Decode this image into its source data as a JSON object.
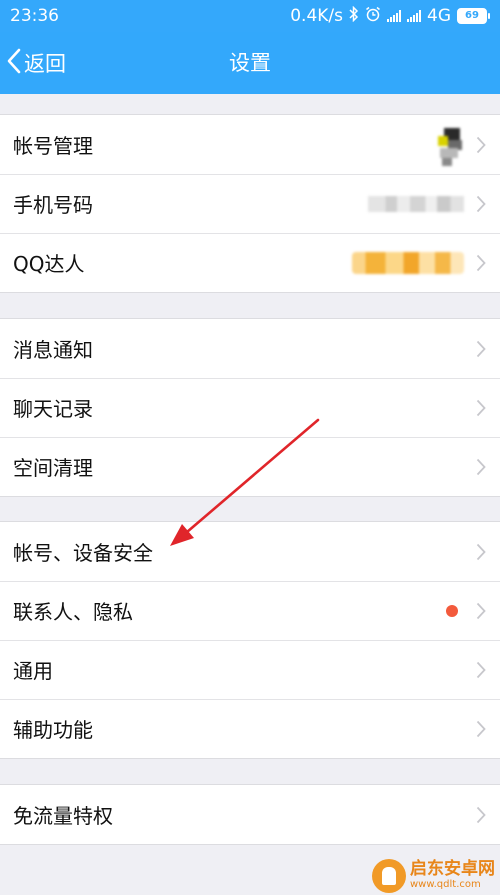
{
  "status_bar": {
    "time": "23:36",
    "network_speed": "0.4K/s",
    "network_type": "4G",
    "battery": "69",
    "icons": [
      "bluetooth-icon",
      "alarm-icon",
      "signal-icon",
      "battery-icon"
    ]
  },
  "nav": {
    "back_label": "返回",
    "title": "设置"
  },
  "groups": [
    {
      "items": [
        {
          "label": "帐号管理"
        },
        {
          "label": "手机号码"
        },
        {
          "label": "QQ达人"
        }
      ]
    },
    {
      "items": [
        {
          "label": "消息通知"
        },
        {
          "label": "聊天记录"
        },
        {
          "label": "空间清理"
        }
      ]
    },
    {
      "items": [
        {
          "label": "帐号、设备安全"
        },
        {
          "label": "联系人、隐私"
        },
        {
          "label": "通用"
        },
        {
          "label": "辅助功能"
        }
      ]
    },
    {
      "items": [
        {
          "label": "免流量特权"
        }
      ]
    }
  ],
  "watermark": {
    "name": "启东安卓网",
    "url": "www.qdlt.com"
  },
  "colors": {
    "header": "#33a8fb",
    "background": "#efeff4",
    "annotation_arrow": "#e0252a",
    "badge_dot": "#f35a3c"
  }
}
